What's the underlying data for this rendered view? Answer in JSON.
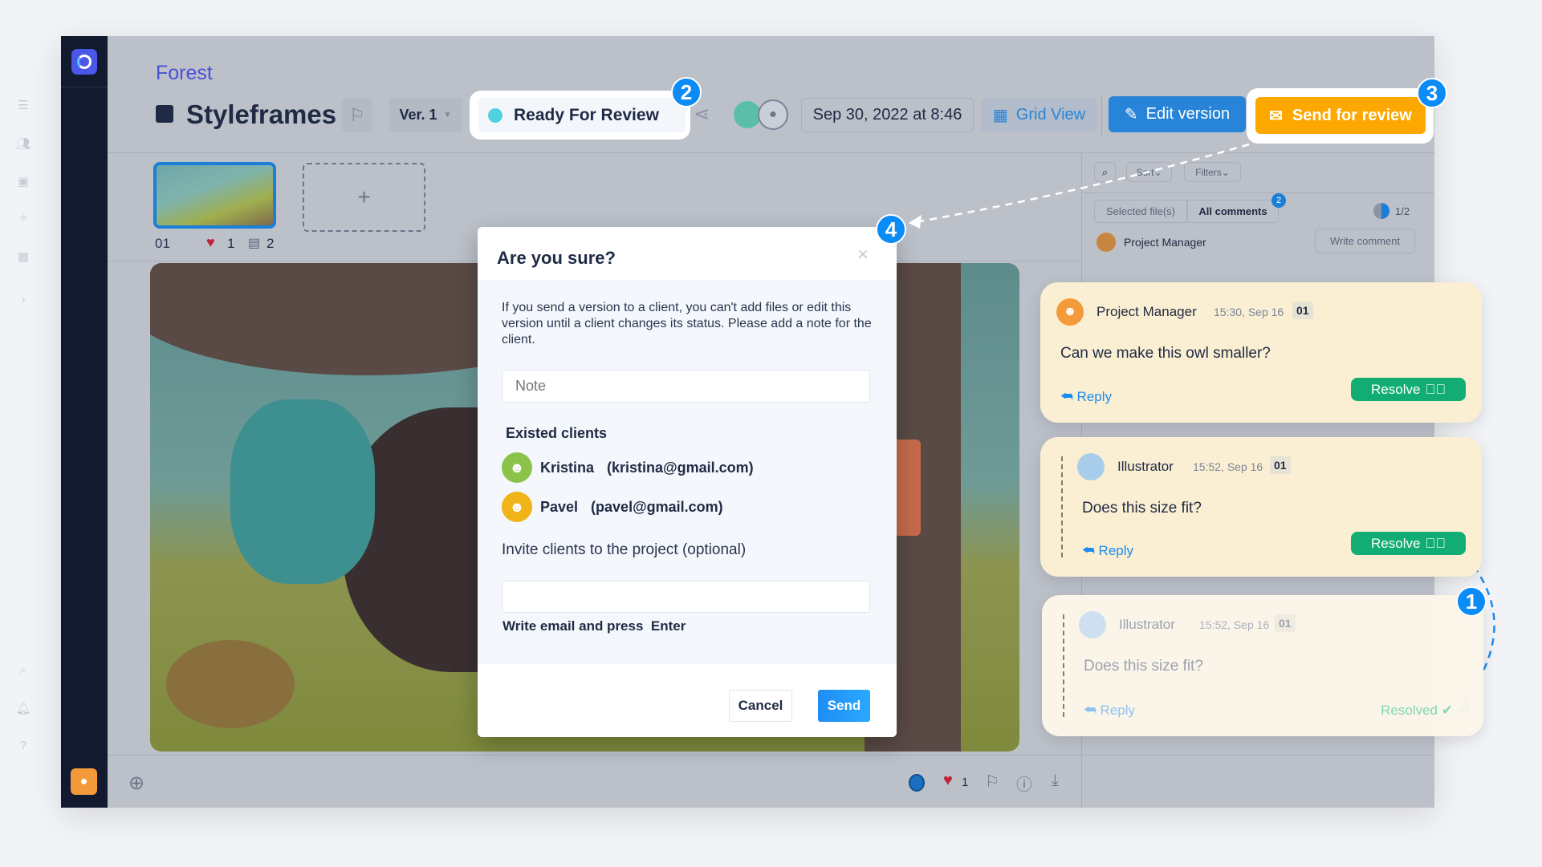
{
  "project": {
    "name": "Forest",
    "title": "Styleframes",
    "version": "Ver. 1",
    "status": "Ready For Review",
    "status_color": "#4fd1e0",
    "date": "Sep 30, 2022 at 8:46"
  },
  "toolbar": {
    "grid_view": "Grid View",
    "edit_version": "Edit version",
    "send_for_review": "Send for review",
    "accent": "#2784d8",
    "send_color": "#fca800"
  },
  "thumbnails": [
    {
      "label": "01",
      "likes": "1",
      "comments": "2"
    }
  ],
  "add_file": "+",
  "sidebar": {
    "icons": [
      "list-icon",
      "users-icon",
      "calendar-icon",
      "timeline-icon",
      "dashboard-icon",
      "chevron-right-icon"
    ],
    "bottom_icons": [
      "search-icon",
      "bell-icon",
      "help-icon",
      "user-avatar"
    ],
    "help": "?",
    "expand": "›"
  },
  "comments_panel": {
    "sort": "Sort",
    "filters": "Filters",
    "tabs": [
      "Selected file(s)",
      "All comments"
    ],
    "all_comments_count": "2",
    "progress": "1/2",
    "current_user": "Project Manager",
    "write_comment": "Write comment"
  },
  "bottom_bar": {
    "likes": "1"
  },
  "modal": {
    "title": "Are you sure?",
    "description": "If you send a version to a client, you can't add files or edit this version until a client changes its status. Please add a note for the client.",
    "note_placeholder": "Note",
    "existed_clients_label": "Existed clients",
    "clients": [
      {
        "name": "Kristina",
        "email": "(kristina@gmail.com)",
        "color": "#8bc34a"
      },
      {
        "name": "Pavel",
        "email": "(pavel@gmail.com)",
        "color": "#f0b418"
      }
    ],
    "invite_label": "Invite clients to the project (optional)",
    "invite_value": "",
    "hint": "Write email and press  Enter",
    "cancel": "Cancel",
    "send": "Send"
  },
  "comments": [
    {
      "author": "Project Manager",
      "time": "15:30, Sep 16",
      "file": "01",
      "text": "Can we make this owl smaller?",
      "reply": "Reply",
      "action": "Resolve"
    },
    {
      "author": "Illustrator",
      "time": "15:52, Sep 16",
      "file": "01",
      "text": "Does this size fit?",
      "reply": "Reply",
      "action": "Resolve"
    },
    {
      "author": "Illustrator",
      "time": "15:52, Sep 16",
      "file": "01",
      "text": "Does this size fit?",
      "reply": "Reply",
      "action": "Resolved"
    }
  ],
  "step_badges": [
    "1",
    "2",
    "3",
    "4"
  ]
}
